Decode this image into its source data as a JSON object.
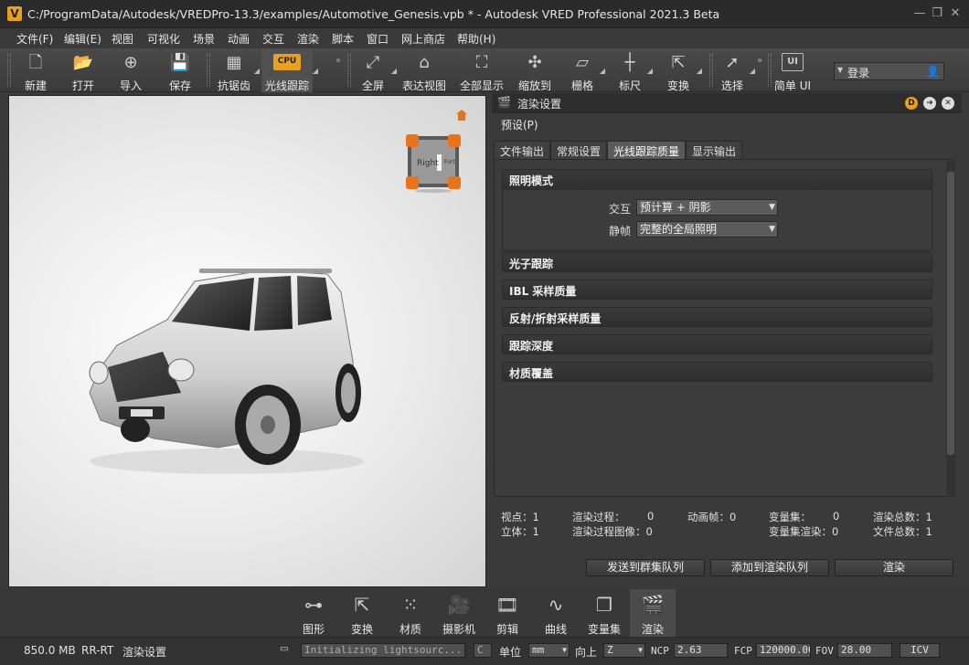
{
  "window": {
    "title": "C:/ProgramData/Autodesk/VREDPro-13.3/examples/Automotive_Genesis.vpb * - Autodesk VRED Professional 2021.3 Beta",
    "logo": "V"
  },
  "menu": [
    "文件(F)",
    "编辑(E)",
    "视图",
    "可视化",
    "场景",
    "动画",
    "交互",
    "渲染",
    "脚本",
    "窗口",
    "网上商店",
    "帮助(H)"
  ],
  "toolbar": {
    "new": "新建",
    "open": "打开",
    "import": "导入",
    "save": "保存",
    "antialias": "抗锯齿",
    "raytrace": "光线跟踪",
    "cpu_badge": "CPU",
    "fullscreen": "全屏",
    "presentation": "表达视图",
    "fitall": "全部显示",
    "zoomto": "缩放到",
    "grid": "栅格",
    "ruler": "标尺",
    "transform": "变换",
    "select": "选择",
    "simple_ui": "简单 UI",
    "ui_badge": "UI"
  },
  "login": {
    "label": "登录"
  },
  "viewcube": {
    "face_right": "Right",
    "face_front": "Fort"
  },
  "panel": {
    "title": "渲染设置",
    "preset": "预设(P)",
    "tabs": [
      "文件输出",
      "常规设置",
      "光线跟踪质量",
      "显示输出"
    ],
    "active_tab": 2,
    "lighting": {
      "title": "照明模式",
      "interactive_label": "交互",
      "interactive_value": "预计算 + 阴影",
      "still_label": "静帧",
      "still_value": "完整的全局照明"
    },
    "sections": [
      "光子跟踪",
      "IBL 采样质量",
      "反射/折射采样质量",
      "跟踪深度",
      "材质覆盖"
    ],
    "stats": {
      "viewpoint": "视点：1",
      "stereo": "立体：1",
      "render_pass": "渲染过程：",
      "render_pass_val": "0",
      "render_pass_img": "渲染过程图像：0",
      "anim_frames": "动画帧：0",
      "variant_sets": "变量集：",
      "variant_sets_val": "0",
      "variant_render": "变量集渲染：0",
      "render_total": "渲染总数：1",
      "file_total": "文件总数：1"
    },
    "buttons": {
      "send_cluster": "发送到群集队列",
      "add_queue": "添加到渲染队列",
      "render": "渲染"
    }
  },
  "modules": [
    "图形",
    "变换",
    "材质",
    "摄影机",
    "剪辑",
    "曲线",
    "变量集",
    "渲染"
  ],
  "active_module": 7,
  "status": {
    "memory": "850.0 MB",
    "mode": "RR-RT",
    "context": "渲染设置",
    "log": "Initializing lightsourc...",
    "unit_label": "单位",
    "unit_value": "mm",
    "up_label": "向上",
    "up_value": "Z",
    "ncp_label": "NCP",
    "ncp_value": "2.63",
    "fcp_label": "FCP",
    "fcp_value": "120000.00",
    "fov_label": "FOV",
    "fov_value": "28.00",
    "icv_label": "ICV"
  },
  "colors": {
    "accent": "#e8a020",
    "panel_bg": "#3a3a3a",
    "viewport_bg": "#f0f0f0"
  }
}
